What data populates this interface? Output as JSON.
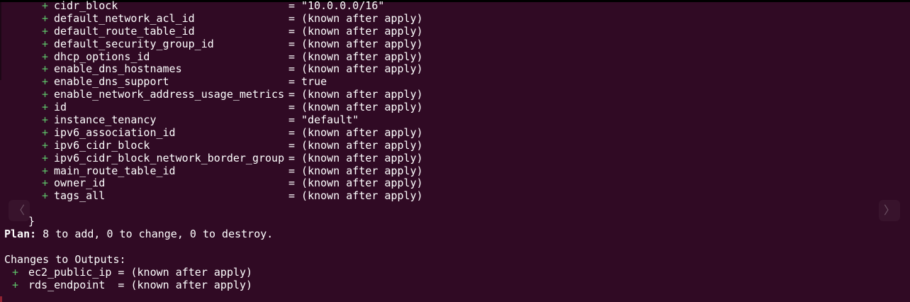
{
  "terminal": {
    "resource_attributes": [
      {
        "sign": "+",
        "name": "cidr_block",
        "value": "= \"10.0.0.0/16\""
      },
      {
        "sign": "+",
        "name": "default_network_acl_id",
        "value": "= (known after apply)"
      },
      {
        "sign": "+",
        "name": "default_route_table_id",
        "value": "= (known after apply)"
      },
      {
        "sign": "+",
        "name": "default_security_group_id",
        "value": "= (known after apply)"
      },
      {
        "sign": "+",
        "name": "dhcp_options_id",
        "value": "= (known after apply)"
      },
      {
        "sign": "+",
        "name": "enable_dns_hostnames",
        "value": "= (known after apply)"
      },
      {
        "sign": "+",
        "name": "enable_dns_support",
        "value": "= true"
      },
      {
        "sign": "+",
        "name": "enable_network_address_usage_metrics",
        "value": "= (known after apply)"
      },
      {
        "sign": "+",
        "name": "id",
        "value": "= (known after apply)"
      },
      {
        "sign": "+",
        "name": "instance_tenancy",
        "value": "= \"default\""
      },
      {
        "sign": "+",
        "name": "ipv6_association_id",
        "value": "= (known after apply)"
      },
      {
        "sign": "+",
        "name": "ipv6_cidr_block",
        "value": "= (known after apply)"
      },
      {
        "sign": "+",
        "name": "ipv6_cidr_block_network_border_group",
        "value": "= (known after apply)"
      },
      {
        "sign": "+",
        "name": "main_route_table_id",
        "value": "= (known after apply)"
      },
      {
        "sign": "+",
        "name": "owner_id",
        "value": "= (known after apply)"
      },
      {
        "sign": "+",
        "name": "tags_all",
        "value": "= (known after apply)"
      }
    ],
    "closing_brace": "}",
    "plan": {
      "label": "Plan:",
      "text": " 8 to add, 0 to change, 0 to destroy."
    },
    "outputs_header": "Changes to Outputs:",
    "outputs": [
      {
        "sign": "+",
        "text": "ec2_public_ip = (known after apply)"
      },
      {
        "sign": "+",
        "text": "rds_endpoint  = (known after apply)"
      }
    ]
  },
  "nav": {
    "left_icon": "chevron-left-icon",
    "left_glyph": "〈",
    "right_icon": "chevron-right-icon",
    "right_glyph": "〉"
  },
  "colors": {
    "background": "#300a24",
    "text": "#ffffff",
    "plus_sign": "#5ec46a"
  }
}
